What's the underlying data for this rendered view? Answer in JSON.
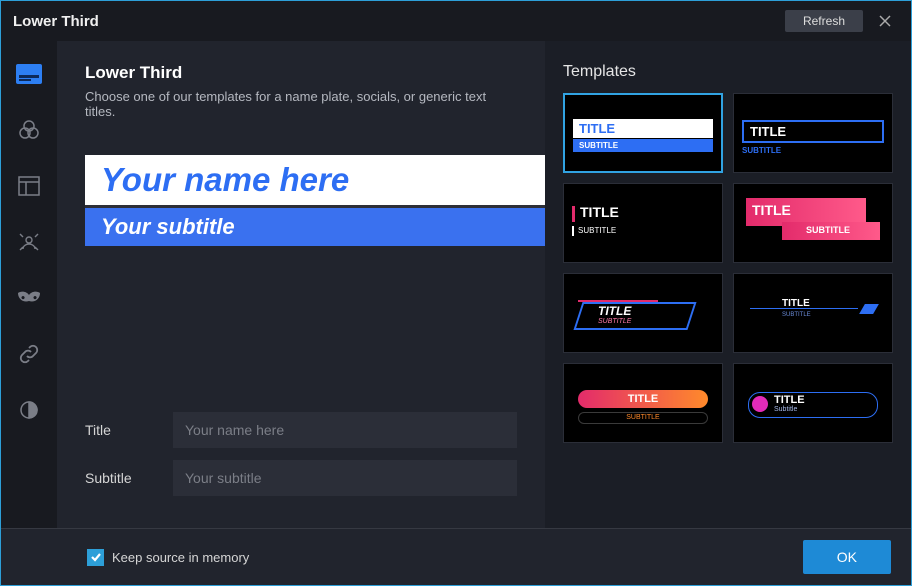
{
  "window": {
    "title": "Lower Third"
  },
  "titlebar": {
    "refresh": "Refresh"
  },
  "sidebar": {
    "items": [
      {
        "name": "lower-third-icon",
        "active": true
      },
      {
        "name": "color-correction-icon"
      },
      {
        "name": "layout-icon"
      },
      {
        "name": "virtual-bg-icon"
      },
      {
        "name": "mask-icon"
      },
      {
        "name": "link-icon"
      },
      {
        "name": "contrast-icon"
      }
    ]
  },
  "content": {
    "heading": "Lower Third",
    "description": "Choose one of our templates for a name plate, socials, or generic text titles.",
    "preview": {
      "title": "Your name here",
      "subtitle": "Your subtitle"
    }
  },
  "form": {
    "title_label": "Title",
    "title_placeholder": "Your name here",
    "title_value": "",
    "subtitle_label": "Subtitle",
    "subtitle_placeholder": "Your subtitle",
    "subtitle_value": ""
  },
  "templates": {
    "heading": "Templates",
    "items": [
      {
        "title": "TITLE",
        "subtitle": "SUBTITLE",
        "selected": true
      },
      {
        "title": "TITLE",
        "subtitle": "SUBTITLE"
      },
      {
        "title": "TITLE",
        "subtitle": "SUBTITLE"
      },
      {
        "title": "TITLE",
        "subtitle": "SUBTITLE"
      },
      {
        "title": "TITLE",
        "subtitle": "SUBTITLE"
      },
      {
        "title": "TITLE",
        "subtitle": "SUBTITLE"
      },
      {
        "title": "TITLE",
        "subtitle": "SUBTITLE"
      },
      {
        "title": "TITLE",
        "subtitle": "Subtitle"
      }
    ]
  },
  "footer": {
    "keep_source": "Keep source in memory",
    "keep_source_checked": true,
    "ok": "OK"
  }
}
